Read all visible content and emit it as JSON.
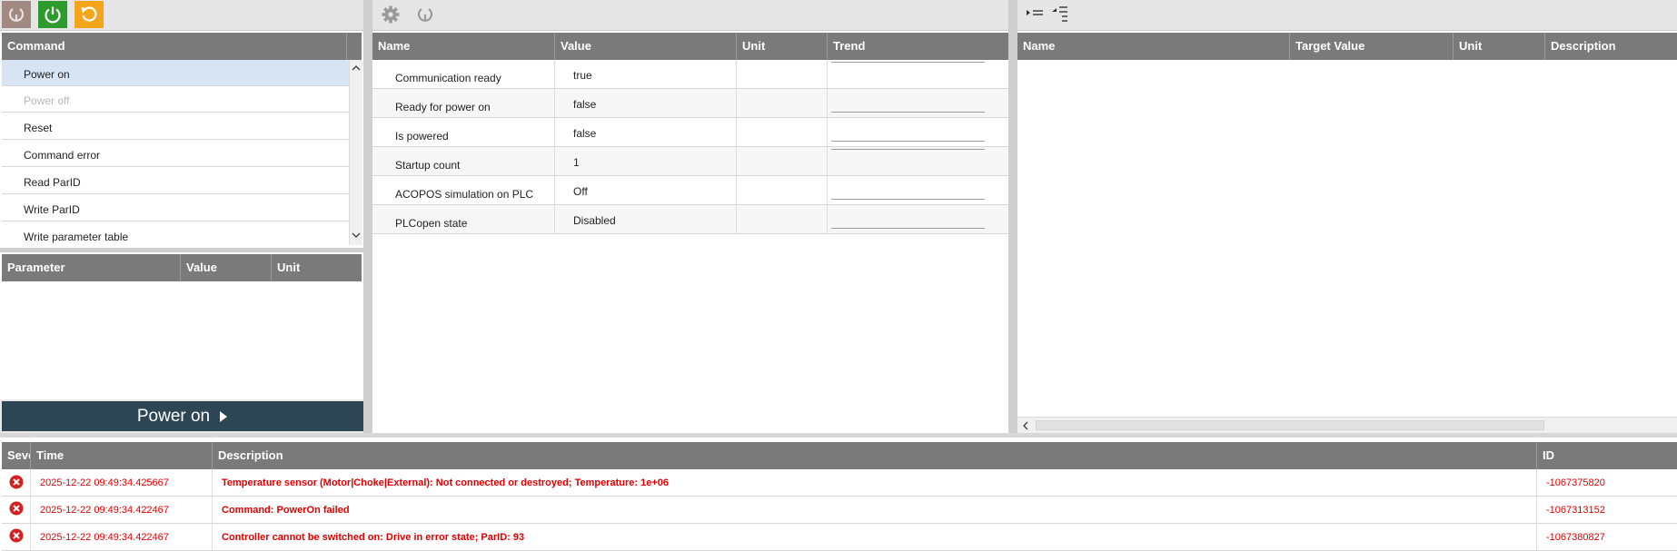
{
  "left": {
    "command_header": "Command",
    "commands": [
      {
        "label": "Power on",
        "selected": true,
        "disabled": false
      },
      {
        "label": "Power off",
        "selected": false,
        "disabled": true
      },
      {
        "label": "Reset",
        "selected": false,
        "disabled": false
      },
      {
        "label": "Command error",
        "selected": false,
        "disabled": false
      },
      {
        "label": "Read ParID",
        "selected": false,
        "disabled": false
      },
      {
        "label": "Write ParID",
        "selected": false,
        "disabled": false
      },
      {
        "label": "Write parameter table",
        "selected": false,
        "disabled": false
      }
    ],
    "param_columns": [
      "Parameter",
      "Value",
      "Unit"
    ],
    "execute_label": "Power on"
  },
  "middle": {
    "columns": [
      "Name",
      "Value",
      "Unit",
      "Trend"
    ],
    "rows": [
      {
        "name": "Communication ready",
        "value": "true",
        "unit": ""
      },
      {
        "name": "Ready for power on",
        "value": "false",
        "unit": ""
      },
      {
        "name": "Is powered",
        "value": "false",
        "unit": ""
      },
      {
        "name": "Startup count",
        "value": "1",
        "unit": ""
      },
      {
        "name": "ACOPOS simulation on PLC",
        "value": "Off",
        "unit": ""
      },
      {
        "name": "PLCopen state",
        "value": "Disabled",
        "unit": ""
      }
    ]
  },
  "right": {
    "columns": [
      "Name",
      "Target Value",
      "Unit",
      "Description"
    ]
  },
  "logger": {
    "columns": [
      "Severity",
      "Time",
      "Description",
      "ID"
    ],
    "entries": [
      {
        "time": "2025-12-22 09:49:34.425667",
        "description": "Temperature sensor (Motor|Choke|External): Not connected or destroyed; Temperature: 1e+06",
        "id": "-1067375820"
      },
      {
        "time": "2025-12-22 09:49:34.422467",
        "description": "Command: PowerOn failed",
        "id": "-1067313152"
      },
      {
        "time": "2025-12-22 09:49:34.422467",
        "description": "Controller cannot be switched on: Drive in error state; ParID: 93",
        "id": "-1067380827"
      }
    ]
  },
  "colors": {
    "header_bg": "#7a7a7a",
    "selected_row": "#d6e4f4",
    "power_on_button": "#2e9b2e",
    "reset_button": "#f4a51c",
    "execute_bar": "#2d4656",
    "error_text": "#e00000"
  },
  "icons": {
    "toolbar_left": [
      "connect-icon",
      "power-icon",
      "reset-icon"
    ],
    "toolbar_middle": [
      "gear-icon",
      "connect-icon"
    ],
    "toolbar_right": [
      "expand-all-icon",
      "collapse-all-icon"
    ],
    "severity": "error-icon"
  }
}
